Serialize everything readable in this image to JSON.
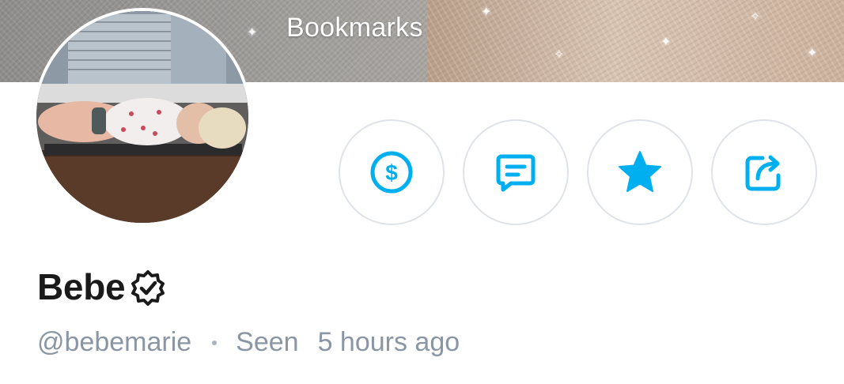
{
  "header": {
    "title": "Bookmarks"
  },
  "profile": {
    "display_name": "Bebe",
    "username": "@bebemarie",
    "status_label": "Seen",
    "last_seen": "5 hours ago",
    "verified": true
  },
  "actions": [
    {
      "icon": "dollar-icon",
      "color": "#00aff0"
    },
    {
      "icon": "message-icon",
      "color": "#00aff0"
    },
    {
      "icon": "star-icon",
      "color": "#00aff0"
    },
    {
      "icon": "share-icon",
      "color": "#00aff0"
    }
  ],
  "colors": {
    "accent": "#00aff0",
    "text_primary": "#1a1a1a",
    "text_secondary": "#8a96a3",
    "button_border": "#dfe3e8"
  }
}
